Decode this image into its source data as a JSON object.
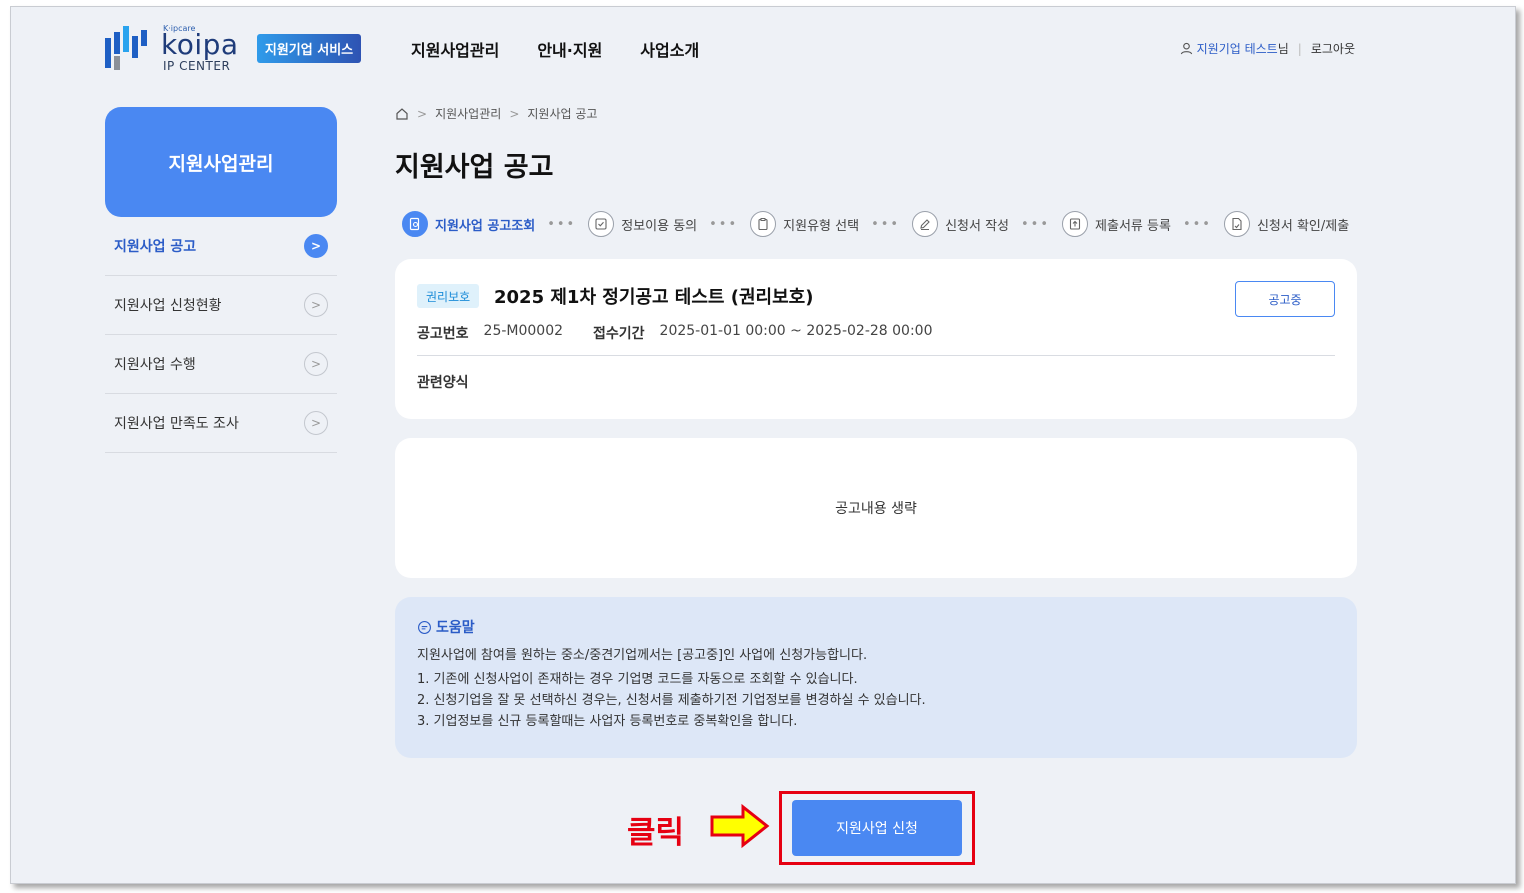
{
  "colors": {
    "accent": "#4a88f2",
    "link": "#2b5cc7",
    "callout": "#e60012",
    "arrow_fill": "#ffff00"
  },
  "header": {
    "logo": {
      "small": "K·ipcare",
      "main": "koipa",
      "sub": "IP CENTER"
    },
    "service_badge": "지원기업 서비스",
    "nav": [
      "지원사업관리",
      "안내·지원",
      "사업소개"
    ],
    "user": {
      "name": "지원기업 테스트",
      "suffix": "님",
      "logout": "로그아웃"
    }
  },
  "sidebar": {
    "title": "지원사업관리",
    "items": [
      {
        "label": "지원사업 공고",
        "active": true
      },
      {
        "label": "지원사업 신청현황"
      },
      {
        "label": "지원사업 수행"
      },
      {
        "label": "지원사업 만족도 조사"
      }
    ]
  },
  "breadcrumb": [
    "지원사업관리",
    "지원사업 공고"
  ],
  "page_title": "지원사업 공고",
  "steps": [
    {
      "label": "지원사업 공고조회",
      "icon": "search-doc-icon"
    },
    {
      "label": "정보이용 동의",
      "icon": "check-box-icon"
    },
    {
      "label": "지원유형 선택",
      "icon": "clipboard-icon"
    },
    {
      "label": "신청서 작성",
      "icon": "pencil-icon"
    },
    {
      "label": "제출서류 등록",
      "icon": "upload-icon"
    },
    {
      "label": "신청서 확인/제출",
      "icon": "doc-check-icon"
    }
  ],
  "notice": {
    "category": "권리보호",
    "title": "2025 제1차 정기공고 테스트 (권리보호)",
    "status": "공고중",
    "number_label": "공고번호",
    "number": "25-M00002",
    "period_label": "접수기간",
    "period": "2025-01-01 00:00 ~ 2025-02-28 00:00",
    "forms_label": "관련양식"
  },
  "content_placeholder": "공고내용 생략",
  "help": {
    "title": "도움말",
    "intro": "지원사업에 참여를 원하는 중소/중견기업께서는 [공고중]인 사업에 신청가능합니다.",
    "items": [
      "1. 기존에 신청사업이 존재하는 경우 기업명 코드를 자동으로 조회할 수 있습니다.",
      "2. 신청기업을 잘 못 선택하신 경우는, 신청서를 제출하기전 기업정보를 변경하실 수 있습니다.",
      "3. 기업정보를 신규 등록할때는 사업자 등록번호로 중복확인을 합니다."
    ]
  },
  "apply_button": "지원사업 신청",
  "annotation": {
    "label": "클릭"
  }
}
